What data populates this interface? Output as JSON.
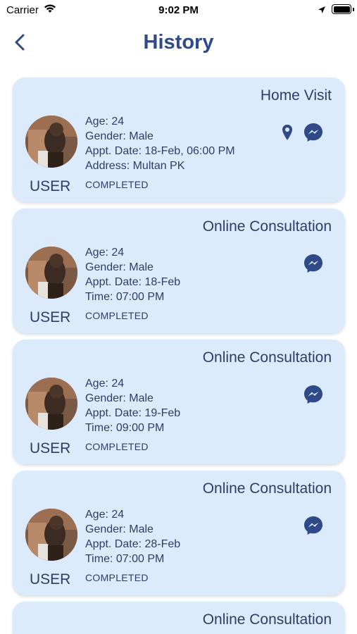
{
  "status_bar": {
    "carrier": "Carrier",
    "time": "9:02 PM"
  },
  "header": {
    "title": "History"
  },
  "colors": {
    "card_bg": "#dcebfb",
    "title": "#2f4a86",
    "text": "#2c3e66",
    "icon": "#2f4a86"
  },
  "cards": [
    {
      "type": "Home Visit",
      "user": "USER",
      "lines": [
        "Age: 24",
        "Gender: Male",
        "Appt. Date: 18-Feb, 06:00 PM",
        "Address: Multan PK"
      ],
      "status": "COMPLETED",
      "icons": [
        "location-pin-icon",
        "messenger-icon"
      ]
    },
    {
      "type": "Online Consultation",
      "user": "USER",
      "lines": [
        "Age: 24",
        "Gender: Male",
        "Appt. Date: 18-Feb",
        "Time: 07:00 PM"
      ],
      "status": "COMPLETED",
      "icons": [
        "messenger-icon"
      ]
    },
    {
      "type": "Online Consultation",
      "user": "USER",
      "lines": [
        "Age: 24",
        "Gender: Male",
        "Appt. Date: 19-Feb",
        "Time: 09:00 PM"
      ],
      "status": "COMPLETED",
      "icons": [
        "messenger-icon"
      ]
    },
    {
      "type": "Online Consultation",
      "user": "USER",
      "lines": [
        "Age: 24",
        "Gender: Male",
        "Appt. Date: 28-Feb",
        "Time: 07:00 PM"
      ],
      "status": "COMPLETED",
      "icons": [
        "messenger-icon"
      ]
    },
    {
      "type": "Online Consultation"
    }
  ]
}
